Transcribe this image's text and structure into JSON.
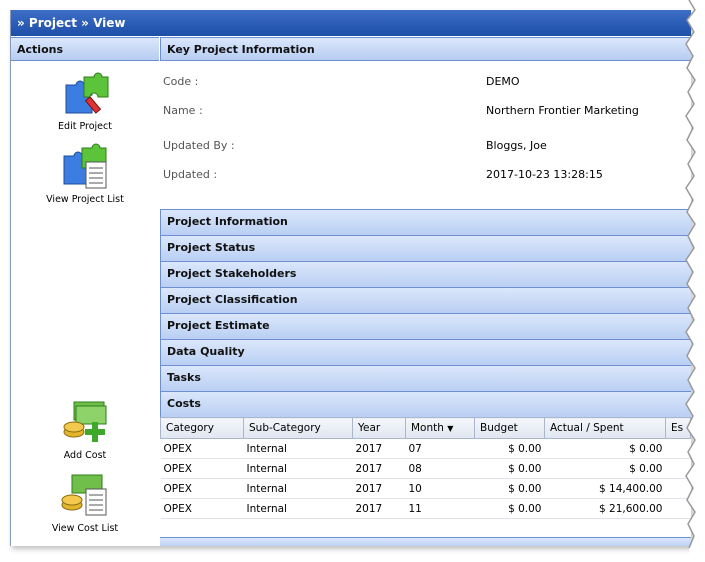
{
  "breadcrumb": "» Project » View",
  "actions": {
    "header": "Actions",
    "items": [
      {
        "label": "Edit Project",
        "icon": "edit-project-icon"
      },
      {
        "label": "View Project List",
        "icon": "project-list-icon"
      },
      {
        "label": "Add Cost",
        "icon": "add-cost-icon"
      },
      {
        "label": "View Cost List",
        "icon": "cost-list-icon"
      }
    ]
  },
  "kpi": {
    "header": "Key Project Information",
    "rows": [
      {
        "label": "Code :",
        "value": "DEMO"
      },
      {
        "label": "Name :",
        "value": "Northern Frontier Marketing"
      },
      {
        "label": "Updated By :",
        "value": "Bloggs, Joe"
      },
      {
        "label": "Updated :",
        "value": "2017-10-23 13:28:15"
      }
    ]
  },
  "panels": [
    "Project Information",
    "Project Status",
    "Project Stakeholders",
    "Project Classification",
    "Project Estimate",
    "Data Quality",
    "Tasks",
    "Costs"
  ],
  "costs": {
    "columns": [
      "Category",
      "Sub-Category",
      "Year",
      "Month",
      "Budget",
      "Actual / Spent",
      "Es"
    ],
    "sort_indicator": "▼",
    "rows": [
      [
        "OPEX",
        "Internal",
        "2017",
        "07",
        "$ 0.00",
        "$ 0.00"
      ],
      [
        "OPEX",
        "Internal",
        "2017",
        "08",
        "$ 0.00",
        "$ 0.00"
      ],
      [
        "OPEX",
        "Internal",
        "2017",
        "10",
        "$ 0.00",
        "$ 14,400.00"
      ],
      [
        "OPEX",
        "Internal",
        "2017",
        "11",
        "$ 0.00",
        "$ 21,600.00"
      ]
    ]
  },
  "colors": {
    "title_bar": "#2a5bb8",
    "section_header": "#c6d8f6",
    "accent_green": "#4caf2a"
  }
}
